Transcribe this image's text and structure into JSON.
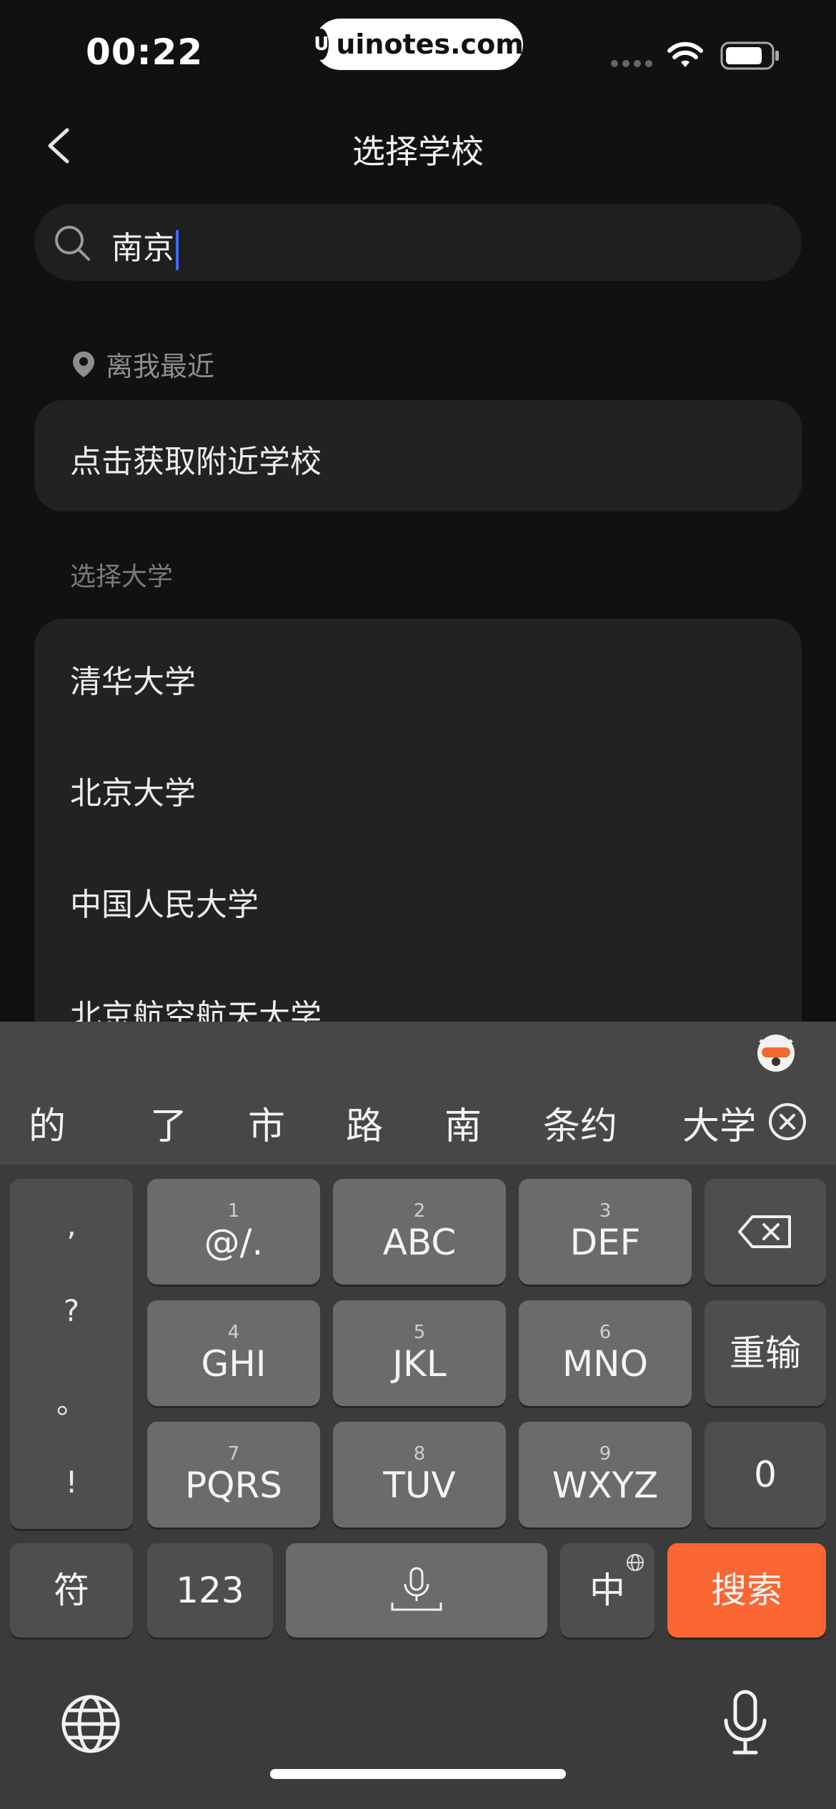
{
  "status_bar": {
    "time": "00:22",
    "brand": "uinotes.com"
  },
  "header": {
    "title": "选择学校"
  },
  "search": {
    "value": "南京"
  },
  "nearby": {
    "label": "离我最近",
    "action": "点击获取附近学校"
  },
  "universities": {
    "section_label": "选择大学",
    "items": [
      "清华大学",
      "北京大学",
      "中国人民大学",
      "北京航空航天大学"
    ]
  },
  "keyboard": {
    "candidates": [
      "的",
      "了",
      "市",
      "路",
      "南",
      "条约",
      "大学"
    ],
    "punct": [
      ",",
      "?",
      "。",
      "!"
    ],
    "keys": [
      {
        "num": "1",
        "label": "@/."
      },
      {
        "num": "2",
        "label": "ABC"
      },
      {
        "num": "3",
        "label": "DEF"
      },
      {
        "num": "4",
        "label": "GHI"
      },
      {
        "num": "5",
        "label": "JKL"
      },
      {
        "num": "6",
        "label": "MNO"
      },
      {
        "num": "7",
        "label": "PQRS"
      },
      {
        "num": "8",
        "label": "TUV"
      },
      {
        "num": "9",
        "label": "WXYZ"
      }
    ],
    "reenter": "重输",
    "zero": "0",
    "symbols": "符",
    "numbers": "123",
    "lang": "中",
    "search": "搜索"
  },
  "colors": {
    "accent": "#fb6632",
    "caret": "#3d6cff",
    "background": "#111111"
  }
}
